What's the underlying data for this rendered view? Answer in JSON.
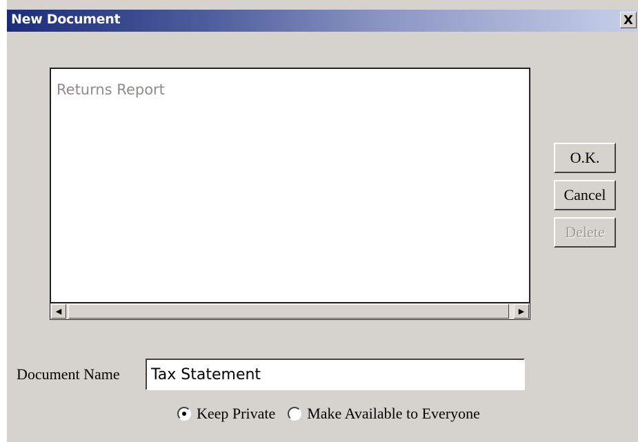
{
  "window": {
    "title": "New Document",
    "close_icon": "close-icon",
    "close_label": "X"
  },
  "list": {
    "items": [
      "Returns Report"
    ]
  },
  "buttons": {
    "ok_label": "O.K.",
    "cancel_label": "Cancel",
    "delete_label": "Delete",
    "delete_disabled": true
  },
  "scrollbar": {
    "left_icon": "left-arrow-icon",
    "right_icon": "right-arrow-icon",
    "left_glyph": "◀",
    "right_glyph": "▶"
  },
  "form": {
    "document_name_label": "Document Name",
    "document_name_value": "Tax Statement",
    "visibility_options": [
      {
        "label": "Keep Private",
        "selected": true
      },
      {
        "label": "Make Available to Everyone",
        "selected": false
      }
    ]
  },
  "colors": {
    "title_gradient_start": "#1c2c7a",
    "title_gradient_end": "#c6cfe8",
    "dialog_background": "#d6d3ce",
    "list_item_text": "#918a88"
  }
}
